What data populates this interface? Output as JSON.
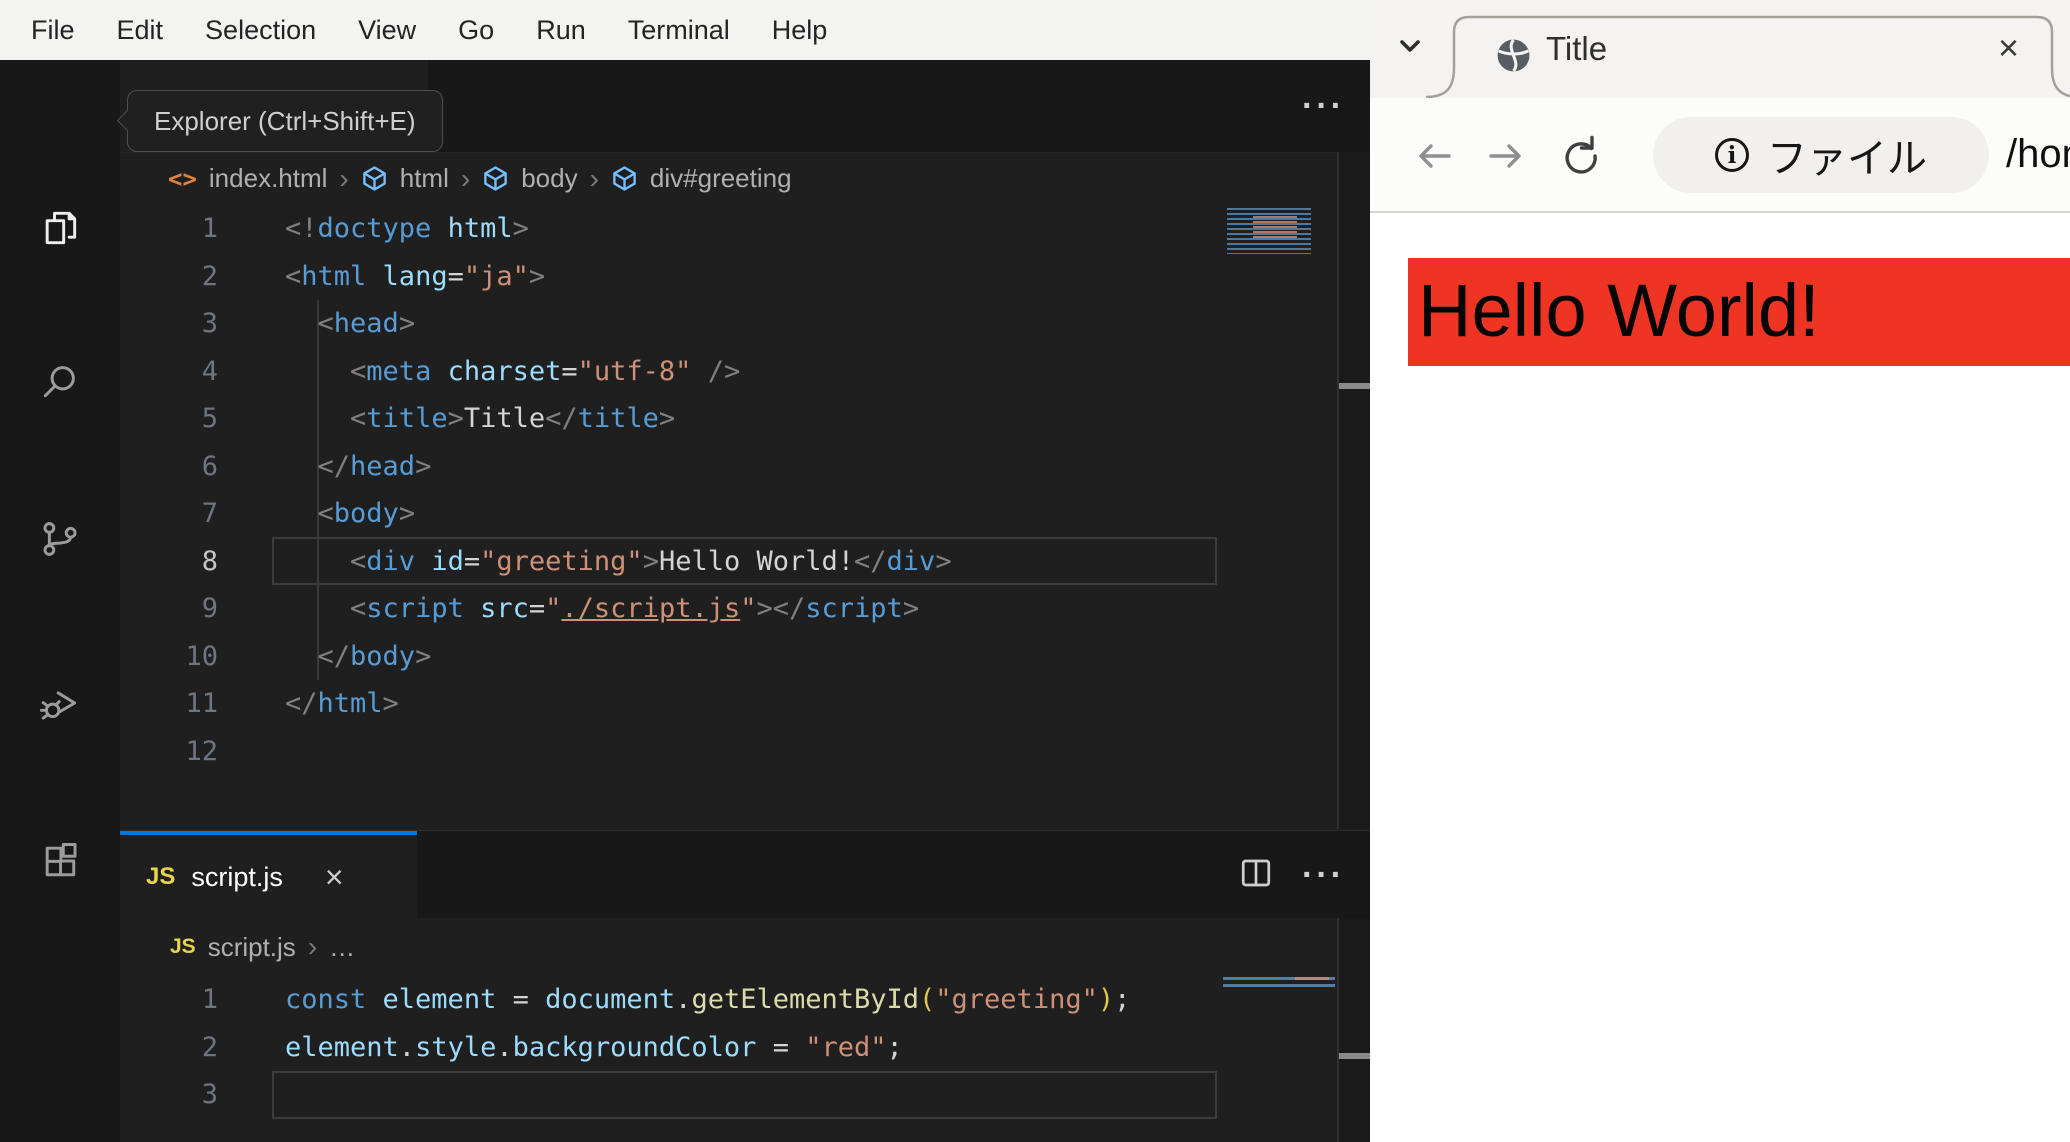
{
  "vscode": {
    "menubar": {
      "items": [
        "File",
        "Edit",
        "Selection",
        "View",
        "Go",
        "Run",
        "Terminal",
        "Help"
      ]
    },
    "activity_bar": {
      "items": [
        "explorer",
        "search",
        "source-control",
        "run-and-debug",
        "extensions"
      ],
      "active": "explorer"
    },
    "tooltip": {
      "text": "Explorer (Ctrl+Shift+E)"
    },
    "breadcrumbs_top": {
      "file": "index.html",
      "path": [
        "html",
        "body",
        "div#greeting"
      ]
    },
    "html_editor": {
      "lines": [
        {
          "n": 1,
          "tokens": [
            [
              "<!",
              "p"
            ],
            [
              "doctype",
              "tag"
            ],
            [
              " html",
              "attr"
            ],
            [
              ">",
              "p"
            ]
          ]
        },
        {
          "n": 2,
          "tokens": [
            [
              "<",
              "p"
            ],
            [
              "html",
              "tag"
            ],
            [
              " lang",
              "attr"
            ],
            [
              "=",
              "fg"
            ],
            [
              "\"ja\"",
              "str"
            ],
            [
              ">",
              "p"
            ]
          ]
        },
        {
          "n": 3,
          "tokens": [
            [
              "  ",
              "fg"
            ],
            [
              "<",
              "p"
            ],
            [
              "head",
              "tag"
            ],
            [
              ">",
              "p"
            ]
          ]
        },
        {
          "n": 4,
          "tokens": [
            [
              "    ",
              "fg"
            ],
            [
              "<",
              "p"
            ],
            [
              "meta",
              "tag"
            ],
            [
              " charset",
              "attr"
            ],
            [
              "=",
              "fg"
            ],
            [
              "\"utf-8\"",
              "str"
            ],
            [
              " ",
              "fg"
            ],
            [
              "/>",
              "p"
            ]
          ]
        },
        {
          "n": 5,
          "tokens": [
            [
              "    ",
              "fg"
            ],
            [
              "<",
              "p"
            ],
            [
              "title",
              "tag"
            ],
            [
              ">",
              "p"
            ],
            [
              "Title",
              "fg"
            ],
            [
              "</",
              "p"
            ],
            [
              "title",
              "tag"
            ],
            [
              ">",
              "p"
            ]
          ]
        },
        {
          "n": 6,
          "tokens": [
            [
              "  ",
              "fg"
            ],
            [
              "</",
              "p"
            ],
            [
              "head",
              "tag"
            ],
            [
              ">",
              "p"
            ]
          ]
        },
        {
          "n": 7,
          "tokens": [
            [
              "  ",
              "fg"
            ],
            [
              "<",
              "p"
            ],
            [
              "body",
              "tag"
            ],
            [
              ">",
              "p"
            ]
          ]
        },
        {
          "n": 8,
          "active": true,
          "tokens": [
            [
              "    ",
              "fg"
            ],
            [
              "<",
              "p"
            ],
            [
              "div",
              "tag"
            ],
            [
              " id",
              "attr"
            ],
            [
              "=",
              "fg"
            ],
            [
              "\"greeting\"",
              "str"
            ],
            [
              ">",
              "p"
            ],
            [
              "Hello World!",
              "fg"
            ],
            [
              "</",
              "p"
            ],
            [
              "div",
              "tag"
            ],
            [
              ">",
              "p"
            ]
          ]
        },
        {
          "n": 9,
          "tokens": [
            [
              "    ",
              "fg"
            ],
            [
              "<",
              "p"
            ],
            [
              "script",
              "tag"
            ],
            [
              " src",
              "attr"
            ],
            [
              "=",
              "fg"
            ],
            [
              "\"",
              "str"
            ],
            [
              "./script.js",
              "str",
              "u"
            ],
            [
              "\"",
              "str"
            ],
            [
              ">",
              "p"
            ],
            [
              "</",
              "p"
            ],
            [
              "script",
              "tag"
            ],
            [
              ">",
              "p"
            ]
          ]
        },
        {
          "n": 10,
          "tokens": [
            [
              "  ",
              "fg"
            ],
            [
              "</",
              "p"
            ],
            [
              "body",
              "tag"
            ],
            [
              ">",
              "p"
            ]
          ]
        },
        {
          "n": 11,
          "tokens": [
            [
              "</",
              "p"
            ],
            [
              "html",
              "tag"
            ],
            [
              ">",
              "p"
            ]
          ]
        },
        {
          "n": 12,
          "tokens": []
        }
      ]
    },
    "panel_tab": {
      "label": "script.js",
      "badge": "JS"
    },
    "breadcrumbs_bottom": {
      "badge": "JS",
      "file": "script.js",
      "more": "…"
    },
    "js_editor": {
      "lines": [
        {
          "n": 1,
          "tokens": [
            [
              "const",
              "kw"
            ],
            [
              " element ",
              "var"
            ],
            [
              "=",
              "fg"
            ],
            [
              " document",
              "var"
            ],
            [
              ".",
              "fg"
            ],
            [
              "getElementById",
              "fn"
            ],
            [
              "(",
              "brk"
            ],
            [
              "\"greeting\"",
              "str"
            ],
            [
              ")",
              "brk"
            ],
            [
              ";",
              "fg"
            ]
          ]
        },
        {
          "n": 2,
          "tokens": [
            [
              "element",
              "var"
            ],
            [
              ".",
              "fg"
            ],
            [
              "style",
              "var"
            ],
            [
              ".",
              "fg"
            ],
            [
              "backgroundColor",
              "var"
            ],
            [
              " = ",
              "fg"
            ],
            [
              "\"red\"",
              "str"
            ],
            [
              ";",
              "fg"
            ]
          ]
        },
        {
          "n": 3,
          "tokens": []
        }
      ]
    },
    "colors": {
      "accent_blue": "#0078d4",
      "editor_bg": "#1f1f1f",
      "bar_bg": "#181818"
    }
  },
  "browser": {
    "tab": {
      "title": "Title"
    },
    "toolbar": {
      "chip_label": "ファイル",
      "url": "/home/u"
    },
    "page": {
      "heading": "Hello World!",
      "heading_bg": "#ee3524"
    }
  },
  "icons": {
    "more_actions": "···",
    "close": "×",
    "breadcrumb_separator": "›",
    "code_file": "<>",
    "info": "i"
  }
}
